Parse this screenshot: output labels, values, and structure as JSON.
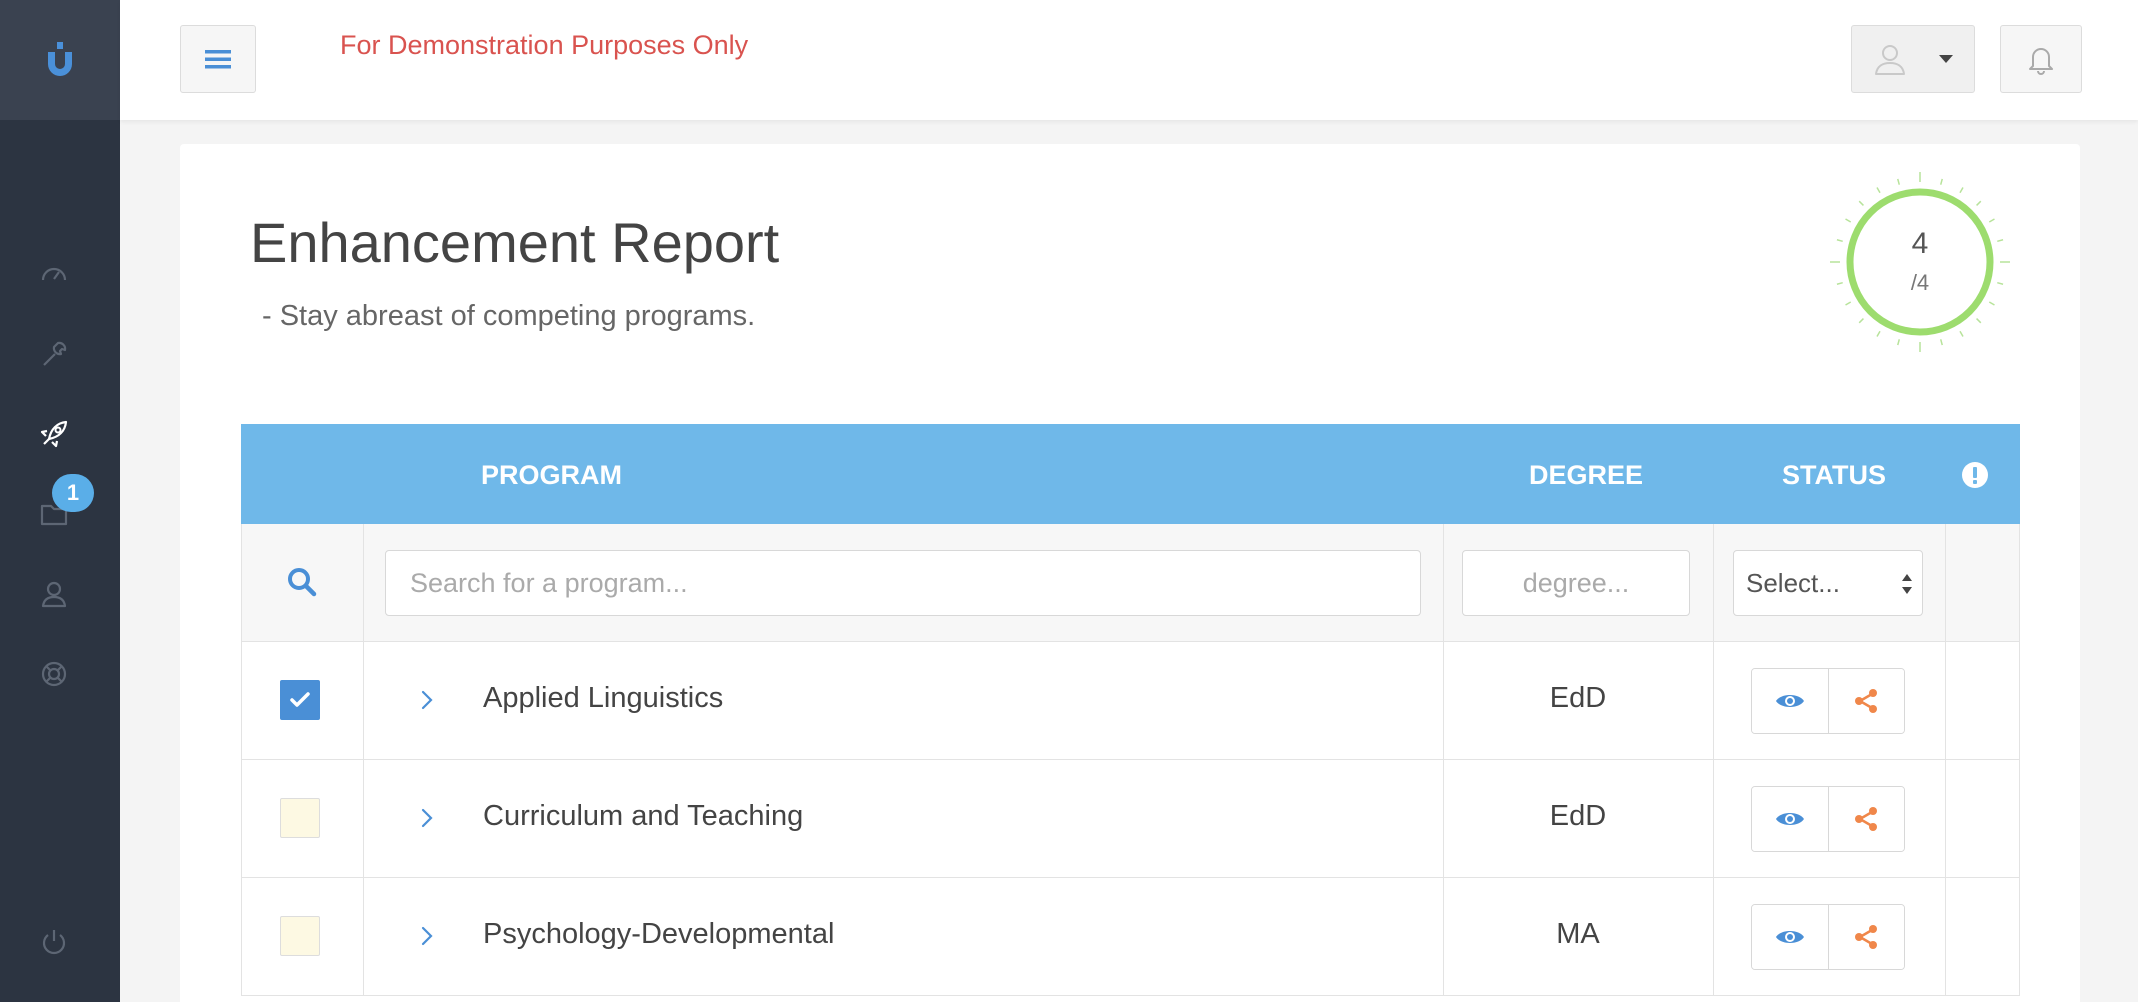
{
  "app": {
    "logo_text": "U"
  },
  "sidebar": {
    "items": [
      {
        "icon": "dashboard-icon"
      },
      {
        "icon": "wrench-icon"
      },
      {
        "icon": "rocket-icon"
      },
      {
        "icon": "folder-icon",
        "badge": "1"
      },
      {
        "icon": "user-icon"
      },
      {
        "icon": "lifebuoy-icon"
      },
      {
        "icon": "power-icon"
      }
    ],
    "badge_count": "1"
  },
  "topbar": {
    "demo_text": "For Demonstration Purposes Only"
  },
  "report": {
    "title": "Enhancement Report",
    "subtitle": "- Stay abreast of competing programs.",
    "gauge": {
      "value": "4",
      "total": "/4"
    }
  },
  "table": {
    "headers": {
      "program": "PROGRAM",
      "degree": "DEGREE",
      "status": "STATUS"
    },
    "filters": {
      "program_placeholder": "Search for a program...",
      "degree_placeholder": "degree...",
      "status_selected": "Select..."
    },
    "rows": [
      {
        "checked": true,
        "program": "Applied Linguistics",
        "degree": "EdD"
      },
      {
        "checked": false,
        "program": "Curriculum and Teaching",
        "degree": "EdD"
      },
      {
        "checked": false,
        "program": "Psychology-Developmental",
        "degree": "MA"
      }
    ]
  },
  "colors": {
    "sidebar_bg": "#2c3441",
    "header_blue": "#6fb8e9",
    "demo_red": "#d9534f",
    "gauge_green": "#9ddc6e",
    "share_orange": "#f0874a",
    "view_blue": "#4a8fd6"
  }
}
